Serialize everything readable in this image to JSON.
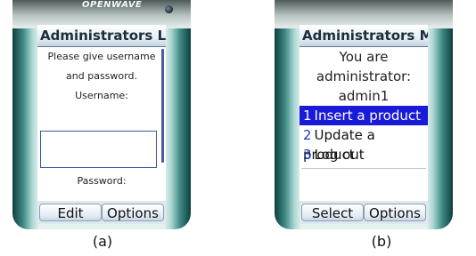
{
  "brand": "OPENWAVE",
  "screen_a": {
    "title": "Administrators L...",
    "lines": [
      "Please give username",
      "and password.",
      "Username:"
    ],
    "password_label": "Password:",
    "username_value": "",
    "softkeys": {
      "left": "Edit",
      "right": "Options"
    }
  },
  "screen_b": {
    "title": "Administrators M...",
    "message": [
      "You are",
      "administrator:",
      "admin1"
    ],
    "menu": [
      {
        "number": "1",
        "label": "Insert a product",
        "selected": true
      },
      {
        "number": "2",
        "label": "Update a product",
        "selected": false
      },
      {
        "number": "3",
        "label": "Log out",
        "selected": false
      }
    ],
    "softkeys": {
      "left": "Select",
      "right": "Options"
    }
  },
  "captions": {
    "a": "(a)",
    "b": "(b)"
  },
  "colors": {
    "selection": "#1a1bd9",
    "menu_number": "#1a3ec2",
    "title_bar": "#e6eef6",
    "frame": "#3f8a85"
  }
}
